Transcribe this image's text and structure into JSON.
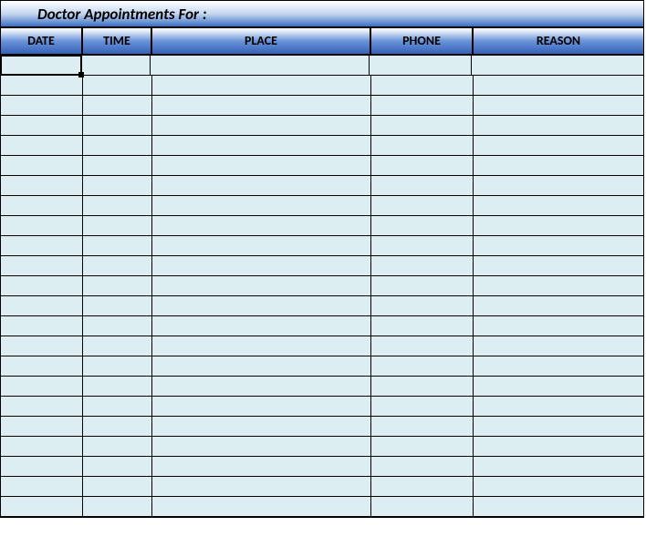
{
  "title": "Doctor Appointments  For :",
  "columns": {
    "date": "DATE",
    "time": "TIME",
    "place": "PLACE",
    "phone": "PHONE",
    "reason": "REASON"
  },
  "rows": [
    {
      "date": "",
      "time": "",
      "place": "",
      "phone": "",
      "reason": ""
    },
    {
      "date": "",
      "time": "",
      "place": "",
      "phone": "",
      "reason": ""
    },
    {
      "date": "",
      "time": "",
      "place": "",
      "phone": "",
      "reason": ""
    },
    {
      "date": "",
      "time": "",
      "place": "",
      "phone": "",
      "reason": ""
    },
    {
      "date": "",
      "time": "",
      "place": "",
      "phone": "",
      "reason": ""
    },
    {
      "date": "",
      "time": "",
      "place": "",
      "phone": "",
      "reason": ""
    },
    {
      "date": "",
      "time": "",
      "place": "",
      "phone": "",
      "reason": ""
    },
    {
      "date": "",
      "time": "",
      "place": "",
      "phone": "",
      "reason": ""
    },
    {
      "date": "",
      "time": "",
      "place": "",
      "phone": "",
      "reason": ""
    },
    {
      "date": "",
      "time": "",
      "place": "",
      "phone": "",
      "reason": ""
    },
    {
      "date": "",
      "time": "",
      "place": "",
      "phone": "",
      "reason": ""
    },
    {
      "date": "",
      "time": "",
      "place": "",
      "phone": "",
      "reason": ""
    },
    {
      "date": "",
      "time": "",
      "place": "",
      "phone": "",
      "reason": ""
    },
    {
      "date": "",
      "time": "",
      "place": "",
      "phone": "",
      "reason": ""
    },
    {
      "date": "",
      "time": "",
      "place": "",
      "phone": "",
      "reason": ""
    },
    {
      "date": "",
      "time": "",
      "place": "",
      "phone": "",
      "reason": ""
    },
    {
      "date": "",
      "time": "",
      "place": "",
      "phone": "",
      "reason": ""
    },
    {
      "date": "",
      "time": "",
      "place": "",
      "phone": "",
      "reason": ""
    },
    {
      "date": "",
      "time": "",
      "place": "",
      "phone": "",
      "reason": ""
    },
    {
      "date": "",
      "time": "",
      "place": "",
      "phone": "",
      "reason": ""
    },
    {
      "date": "",
      "time": "",
      "place": "",
      "phone": "",
      "reason": ""
    },
    {
      "date": "",
      "time": "",
      "place": "",
      "phone": "",
      "reason": ""
    },
    {
      "date": "",
      "time": "",
      "place": "",
      "phone": "",
      "reason": ""
    }
  ],
  "selected_cell": {
    "row": 0,
    "col": "date"
  }
}
